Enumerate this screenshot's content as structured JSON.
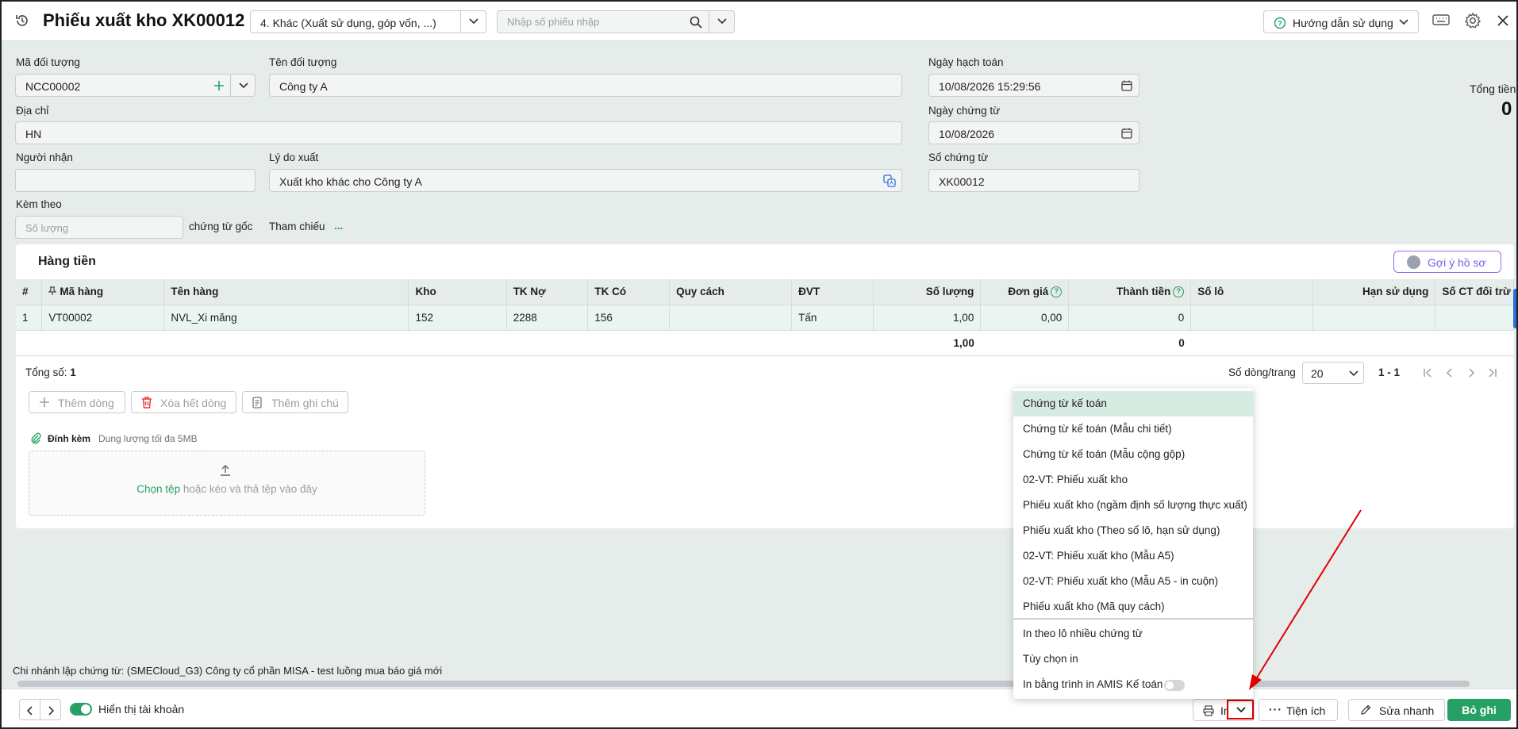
{
  "header": {
    "title": "Phiếu xuất kho XK00012",
    "type_value": "4. Khác (Xuất sử dụng, góp vốn, ...)",
    "search_placeholder": "Nhập số phiếu nhập",
    "help_label": "Hướng dẫn sử dụng"
  },
  "form": {
    "object_code_label": "Mã đối tượng",
    "object_code_value": "NCC00002",
    "object_name_label": "Tên đối tượng",
    "object_name_value": "Công ty A",
    "address_label": "Địa chỉ",
    "address_value": "HN",
    "receiver_label": "Người nhận",
    "receiver_value": "",
    "reason_label": "Lý do xuất",
    "reason_value": "Xuất kho khác cho Công ty A",
    "attach_label": "Kèm theo",
    "attach_placeholder": "Số lượng",
    "attach_suffix": "chứng từ gốc",
    "reference_label": "Tham chiếu",
    "reference_link": "...",
    "posting_date_label": "Ngày hạch toán",
    "posting_date_value": "10/08/2026 15:29:56",
    "doc_date_label": "Ngày chứng từ",
    "doc_date_value": "10/08/2026",
    "doc_no_label": "Số chứng từ",
    "doc_no_value": "XK00012",
    "total_label": "Tổng tiền",
    "total_value": "0"
  },
  "panel": {
    "title": "Hàng tiền",
    "suggest_label": "Gợi ý hồ sơ"
  },
  "table": {
    "columns": [
      "#",
      "Mã hàng",
      "Tên hàng",
      "Kho",
      "TK Nợ",
      "TK Có",
      "Quy cách",
      "ĐVT",
      "Số lượng",
      "Đơn giá",
      "Thành tiền",
      "Số lô",
      "Hạn sử dụng",
      "Số CT đối trừ"
    ],
    "rows": [
      [
        "1",
        "VT00002",
        "NVL_Xi măng",
        "152",
        "2288",
        "156",
        "",
        "Tấn",
        "1,00",
        "0,00",
        "0",
        "",
        "",
        ""
      ]
    ],
    "sum_quantity": "1,00",
    "sum_amount": "0"
  },
  "pagination": {
    "total_label": "Tổng số:",
    "total_count": "1",
    "rows_per_page_label": "Số dòng/trang",
    "rows_per_page_value": "20",
    "range": "1 - 1"
  },
  "actions": {
    "add_row": "Thêm dòng",
    "delete_rows": "Xóa hết dòng",
    "add_note": "Thêm ghi chú"
  },
  "attachment": {
    "label": "Đính kèm",
    "note": "Dung lượng tối đa 5MB",
    "choose_link": "Chọn tệp",
    "drop_text": "hoặc kéo và thả tệp vào đây"
  },
  "branch_text": "Chi nhánh lập chứng từ: (SMECloud_G3) Công ty cổ phần MISA - test luồng mua báo giá mới",
  "footer": {
    "show_account_label": "Hiển thị tài khoản",
    "print_label": "In",
    "utilities_label": "Tiện ích",
    "quick_edit_label": "Sửa nhanh",
    "unpost_label": "Bỏ ghi"
  },
  "print_menu": {
    "items": [
      "Chứng từ kế toán",
      "Chứng từ kế toán (Mẫu chi tiết)",
      "Chứng từ kế toán (Mẫu cộng gộp)",
      "02-VT: Phiếu xuất kho",
      "Phiếu xuất kho (ngầm định số lượng thực xuất)",
      "Phiếu xuất kho (Theo số lô, hạn sử dụng)",
      "02-VT: Phiếu xuất kho (Mẫu A5)",
      "02-VT: Phiếu xuất kho (Mẫu A5  - in cuộn)",
      "Phiếu xuất kho (Mã quy cách)"
    ],
    "extra_items": [
      "In theo lô nhiều chứng từ",
      "Tùy chọn in",
      "In bằng trình in AMIS Kế toán"
    ]
  },
  "colors": {
    "accent": "#27a065",
    "highlight": "#e00000",
    "suggest": "#7b5cf0"
  }
}
